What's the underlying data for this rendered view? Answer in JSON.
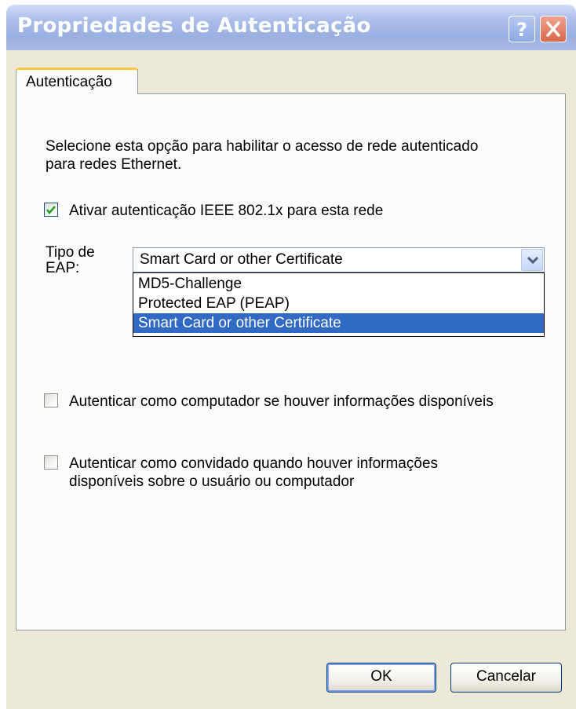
{
  "window": {
    "title": "Propriedades de Autenticação"
  },
  "tabs": [
    {
      "label": "Autenticação",
      "active": true
    }
  ],
  "content": {
    "description_line1": "Selecione esta opção para habilitar o acesso de rede autenticado",
    "description_line2": "para redes Ethernet.",
    "enable_checkbox": {
      "label": "Ativar autenticação IEEE 802.1x para esta rede",
      "checked": true
    },
    "eap": {
      "label_line1": "Tipo de",
      "label_line2": "EAP:",
      "selected": "Smart Card or other Certificate",
      "options": [
        "MD5-Challenge",
        "Protected EAP (PEAP)",
        "Smart Card or other Certificate"
      ],
      "highlighted_index": 2
    },
    "computer_checkbox": {
      "label": "Autenticar como computador se houver informações disponíveis",
      "checked": false
    },
    "guest_checkbox": {
      "label_line1": "Autenticar como convidado quando houver informações",
      "label_line2": "disponíveis sobre o usuário ou computador",
      "checked": false
    }
  },
  "buttons": {
    "ok": "OK",
    "cancel": "Cancelar"
  },
  "icons": {
    "help": "help-icon",
    "close": "close-icon",
    "check": "checkmark-icon",
    "dropdown": "chevron-down-icon"
  },
  "colors": {
    "titlebar": "#a9bdea",
    "selection": "#316ac5",
    "close_button": "#d9664b",
    "tab_accent": "#ffc83c",
    "check": "#21a121"
  }
}
